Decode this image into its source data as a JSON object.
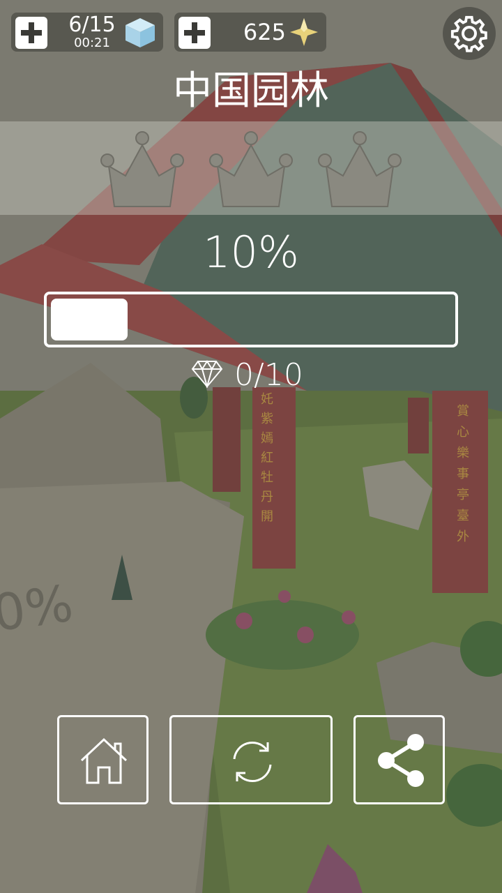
{
  "hud": {
    "energy_count": "6/15",
    "energy_timer": "00:21",
    "currency": "625"
  },
  "level": {
    "title": "中国园林",
    "progress_text": "10%",
    "progress_fraction": 0.1,
    "gems_text": "0/10",
    "crowns_earned": 0,
    "crowns_total": 3
  },
  "scene": {
    "left_pillar_text": "奼紫嫣紅牡丹開",
    "right_pillar_text": "賞心樂事亭臺外",
    "rock_text": "0%"
  },
  "colors": {
    "roof": "#9a3d3d",
    "grass": "#5f7a3a",
    "accent_gold": "#e8d27a"
  }
}
